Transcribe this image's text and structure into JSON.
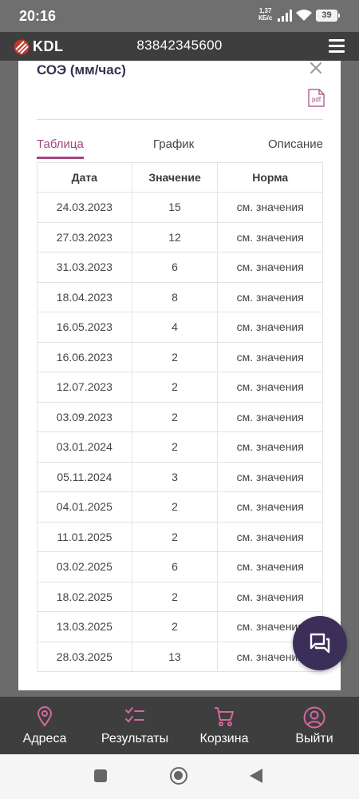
{
  "status_bar": {
    "time": "20:16",
    "net_speed_value": "1,37",
    "net_speed_unit": "КБ/с",
    "battery": "39"
  },
  "header": {
    "logo": "KDL",
    "phone": "83842345600"
  },
  "modal": {
    "title": "СОЭ (мм/час)",
    "pdf_label": "pdf",
    "tabs": [
      "Таблица",
      "График",
      "Описание"
    ],
    "active_tab": "Таблица",
    "table": {
      "headers": [
        "Дата",
        "Значение",
        "Норма"
      ],
      "rows": [
        [
          "24.03.2023",
          "15",
          "см. значения"
        ],
        [
          "27.03.2023",
          "12",
          "см. значения"
        ],
        [
          "31.03.2023",
          "6",
          "см. значения"
        ],
        [
          "18.04.2023",
          "8",
          "см. значения"
        ],
        [
          "16.05.2023",
          "4",
          "см. значения"
        ],
        [
          "16.06.2023",
          "2",
          "см. значения"
        ],
        [
          "12.07.2023",
          "2",
          "см. значения"
        ],
        [
          "03.09.2023",
          "2",
          "см. значения"
        ],
        [
          "03.01.2024",
          "2",
          "см. значения"
        ],
        [
          "05.11.2024",
          "3",
          "см. значения"
        ],
        [
          "04.01.2025",
          "2",
          "см. значения"
        ],
        [
          "11.01.2025",
          "2",
          "см. значения"
        ],
        [
          "03.02.2025",
          "6",
          "см. значения"
        ],
        [
          "18.02.2025",
          "2",
          "см. значения"
        ],
        [
          "13.03.2025",
          "2",
          "см. значения"
        ],
        [
          "28.03.2025",
          "13",
          "см. значения"
        ]
      ]
    }
  },
  "bottom_nav": [
    {
      "label": "Адреса",
      "icon": "location-pin-icon"
    },
    {
      "label": "Результаты",
      "icon": "checklist-icon"
    },
    {
      "label": "Корзина",
      "icon": "cart-icon"
    },
    {
      "label": "Выйти",
      "icon": "user-icon"
    }
  ],
  "colors": {
    "accent": "#a3467f",
    "header_bg": "#3e3e3e",
    "fab_bg": "#3b2f59"
  }
}
